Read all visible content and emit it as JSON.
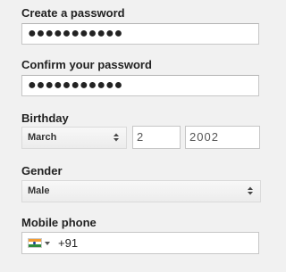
{
  "password": {
    "label": "Create a password",
    "value": "●●●●●●●●●●●"
  },
  "confirm_password": {
    "label": "Confirm your password",
    "value": "●●●●●●●●●●●"
  },
  "birthday": {
    "label": "Birthday",
    "month": "March",
    "day": "2",
    "year": "2002"
  },
  "gender": {
    "label": "Gender",
    "value": "Male"
  },
  "mobile_phone": {
    "label": "Mobile phone",
    "country_icon": "india-flag-icon",
    "dial_code": "+91"
  },
  "colors": {
    "background": "#f1f1f1",
    "input_border": "#c6c6c6",
    "select_bg": "#f0f0f0"
  }
}
